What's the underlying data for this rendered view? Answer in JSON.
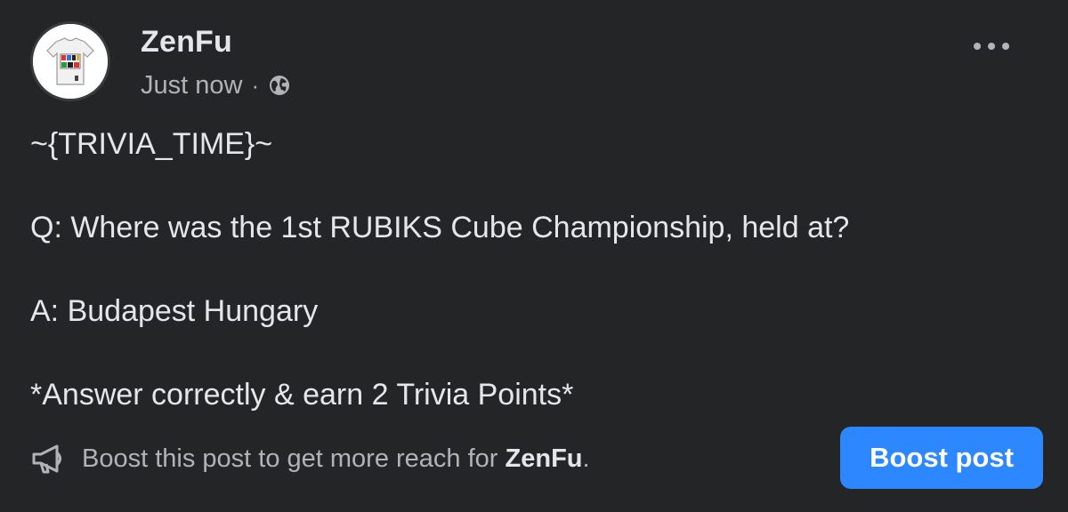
{
  "post": {
    "author": "ZenFu",
    "timestamp": "Just now",
    "separator": "·",
    "privacy_icon": "globe-icon",
    "options_icon": "more-options-icon",
    "avatar_icon": "tshirt-avatar-icon",
    "body": [
      "~{TRIVIA_TIME}~",
      "Q: Where was the 1st RUBIKS Cube Championship, held at?",
      "A: Budapest Hungary",
      "*Answer correctly & earn 2 Trivia Points*"
    ]
  },
  "footer": {
    "icon": "megaphone-icon",
    "boost_text_prefix": "Boost this post to get more reach for ",
    "boost_text_name": "ZenFu",
    "boost_text_suffix": ".",
    "boost_button_label": "Boost post"
  },
  "colors": {
    "background": "#242526",
    "primary_text": "#e4e6eb",
    "secondary_text": "#b0b3b8",
    "accent": "#2d88ff"
  }
}
